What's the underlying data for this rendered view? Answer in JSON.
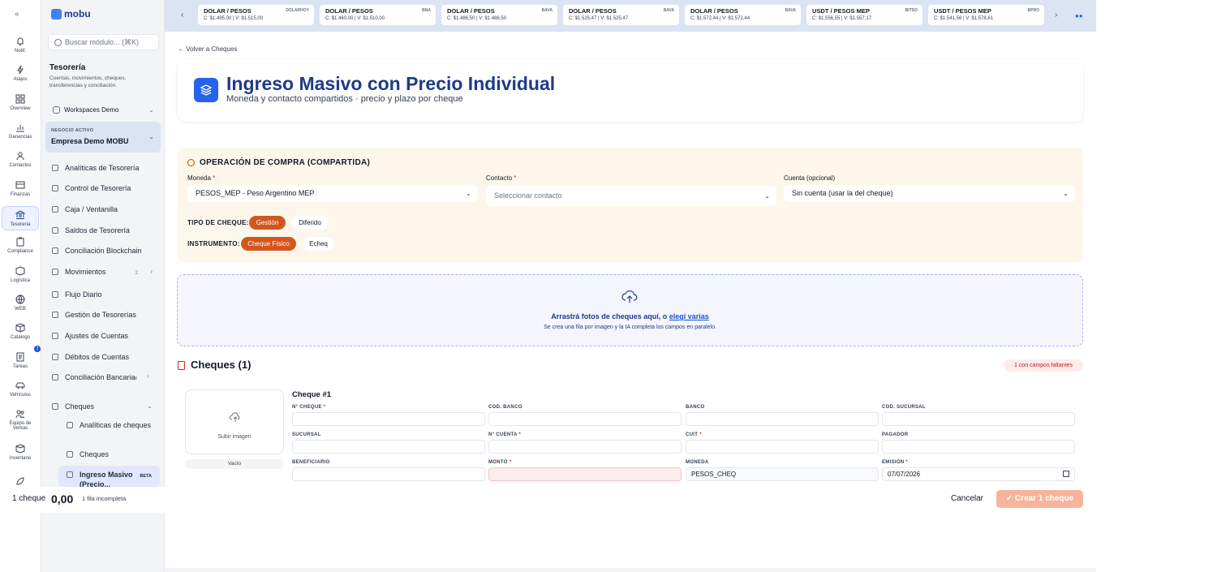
{
  "rail": {
    "items": [
      {
        "label": "Notif."
      },
      {
        "label": "Atajos"
      },
      {
        "label": "Overview"
      },
      {
        "label": "Ganancias"
      },
      {
        "label": "Contactos"
      },
      {
        "label": "Finanzas"
      },
      {
        "label": "Tesorería"
      },
      {
        "label": "Compliance"
      },
      {
        "label": "Logística"
      },
      {
        "label": "WEB"
      },
      {
        "label": "Catálogo"
      },
      {
        "label": "Tareas"
      },
      {
        "label": "Vehículos"
      },
      {
        "label": "Equipo de Ventas"
      },
      {
        "label": "Inventario"
      }
    ],
    "tasks_badge": "2"
  },
  "sidebar": {
    "logo": "mobu",
    "search_placeholder": "Buscar módulo... (⌘K)",
    "title": "Tesorería",
    "subtitle": "Cuentas, movimientos, cheques, transferencias y conciliación.",
    "workspace": "Workspaces Demo",
    "negocio_label": "NEGOCIO ACTIVO",
    "negocio_value": "Empresa Demo MOBU",
    "nav": [
      {
        "label": "Analíticas de Tesorería"
      },
      {
        "label": "Control de Tesorería"
      },
      {
        "label": "Caja / Ventanilla"
      },
      {
        "label": "Saldos de Tesorería"
      },
      {
        "label": "Conciliación Blockchain"
      },
      {
        "label": "Movimientos",
        "count": "2"
      },
      {
        "label": "Flujo Diario"
      },
      {
        "label": "Gestión de Tesorerías"
      },
      {
        "label": "Ajustes de Cuentas"
      },
      {
        "label": "Débitos de Cuentas"
      },
      {
        "label": "Conciliación Bancaria",
        "count": "4"
      },
      {
        "label": "Cheques"
      }
    ],
    "sub": [
      {
        "label": "Analíticas de cheques"
      },
      {
        "label": "Cheques"
      },
      {
        "label": "Ingreso Masivo (Precio...",
        "tag": "BETA"
      }
    ]
  },
  "ticker": [
    {
      "pair": "DOLAR / PESOS",
      "tag": "DOLARHOY",
      "buy": "C: $1.495,00",
      "sell": "V: $1.515,00"
    },
    {
      "pair": "DOLAR / PESOS",
      "tag": "BNA",
      "buy": "C: $1.460,00",
      "sell": "V: $1.510,00"
    },
    {
      "pair": "DOLAR / PESOS",
      "tag": "BAVA",
      "buy": "C: $1.486,50",
      "sell": "V: $1.486,50"
    },
    {
      "pair": "DOLAR / PESOS",
      "tag": "BAVA",
      "buy": "C: $1.525,47",
      "sell": "V: $1.525,47"
    },
    {
      "pair": "DOLAR / PESOS",
      "tag": "BAVA",
      "buy": "C: $1.572,44",
      "sell": "V: $1.572,44"
    },
    {
      "pair": "USDT / PESOS MEP",
      "tag": "BITSO",
      "buy": "C: $1.556,55",
      "sell": "V: $1.557,17"
    },
    {
      "pair": "USDT / PESOS MEP",
      "tag": "BPRO",
      "buy": "C: $1.541,56",
      "sell": "V: $1.578,61"
    }
  ],
  "main": {
    "back_link": "Volver a Cheques",
    "title": "Ingreso Masivo con Precio Individual",
    "subtitle": "Moneda y contacto compartidos · precio y plazo por cheque",
    "op_title": "OPERACIÓN DE COMPRA (COMPARTIDA)",
    "moneda_label": "Moneda",
    "moneda_value": "PESOS_MEP - Peso Argentino MEP",
    "contacto_label": "Contacto",
    "contacto_placeholder": "Seleccionar contacto",
    "cuenta_label": "Cuenta (opcional)",
    "cuenta_value": "Sin cuenta (usar la del cheque)",
    "tipo_label": "TIPO DE CHEQUE:",
    "tipo_options": [
      "Gestión",
      "Diferido"
    ],
    "instr_label": "INSTRUMENTO:",
    "instr_options": [
      "Cheque Físico",
      "Echeq"
    ],
    "drop_text": "Arrastrá fotos de cheques aquí, o",
    "drop_link": "elegí varias",
    "drop_sub": "Se crea una fila por imagen y la IA completa los campos en paralelo.",
    "cheques_title": "Cheques (1)",
    "missing_badge": "1 con campos faltantes",
    "cheque": {
      "title": "Cheque #1",
      "upload_label": "Subir imagen",
      "status": "Vacío",
      "fields": {
        "n_cheque": "N° CHEQUE",
        "cod_banco": "COD. BANCO",
        "banco": "BANCO",
        "cod_sucursal": "COD. SUCURSAL",
        "sucursal": "SUCURSAL",
        "n_cuenta": "N° CUENTA",
        "cuit": "CUIT",
        "pagador": "PAGADOR",
        "beneficiario": "BENEFICIARIO",
        "monto": "MONTO",
        "moneda": "MONEDA",
        "emision": "EMISIÓN"
      },
      "moneda_value": "PESOS_CHEQ",
      "emision_value": "07/07/2026"
    }
  },
  "footer": {
    "count": "1 cheque",
    "total": "0,00",
    "incomplete": "1 fila incompleta",
    "cancel": "Cancelar",
    "create": "Crear 1 cheque"
  },
  "colors": {
    "accent": "#d4561f",
    "brand": "#1e3a8a",
    "primary": "#2563eb"
  }
}
